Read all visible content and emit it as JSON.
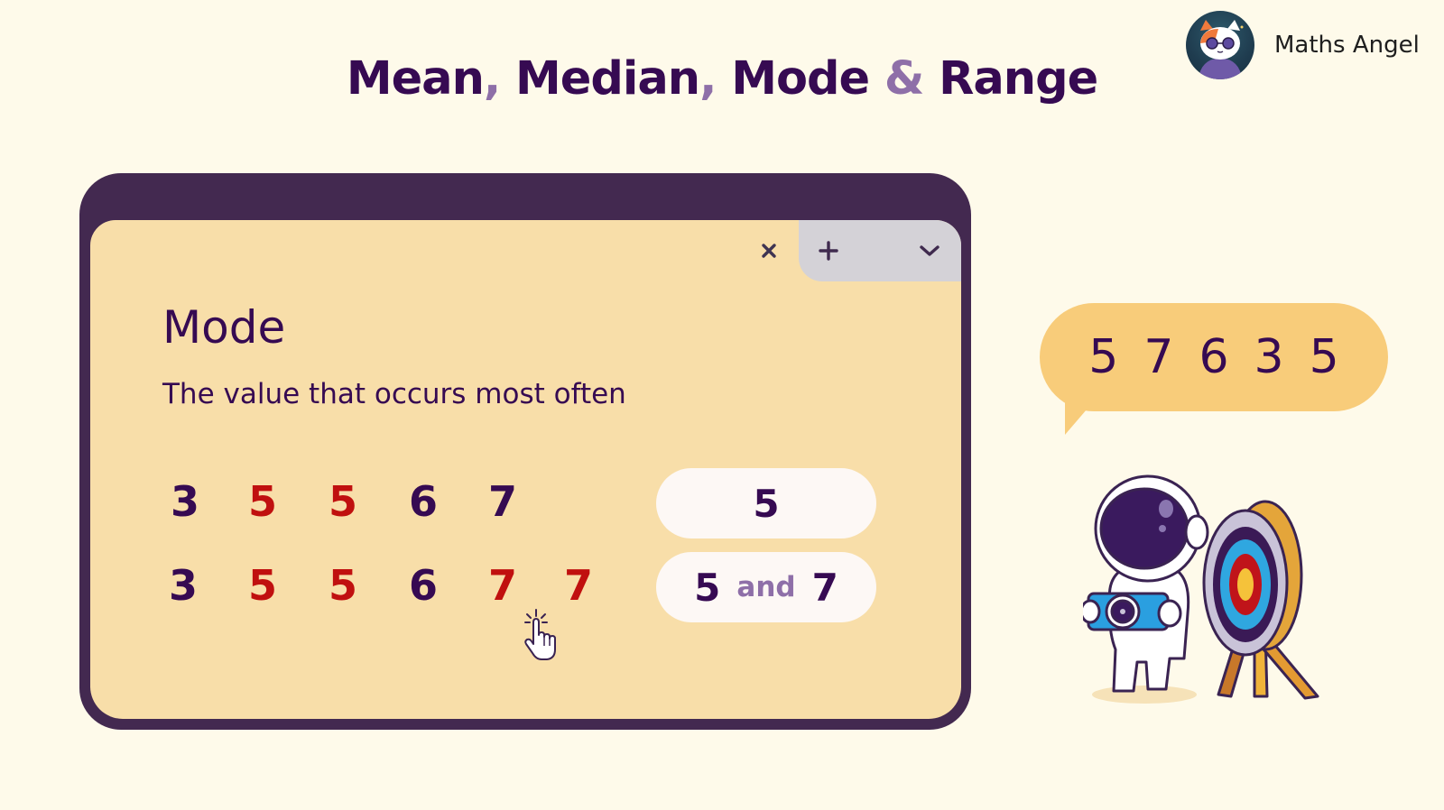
{
  "header": {
    "title_parts": [
      "Mean",
      ",",
      " Median",
      ",",
      " Mode",
      " & ",
      "Range"
    ]
  },
  "brand": {
    "name": "Maths Angel",
    "avatar_icon": "cat-with-sunglasses-avatar"
  },
  "browser": {
    "tab_close_icon": "close-icon",
    "tab_new_icon": "plus-icon",
    "tab_menu_icon": "chevron-down-icon",
    "card": {
      "title": "Mode",
      "description": "The value that occurs most often",
      "examples": [
        {
          "values": [
            {
              "v": "3",
              "is_mode": false
            },
            {
              "v": "5",
              "is_mode": true
            },
            {
              "v": "5",
              "is_mode": true
            },
            {
              "v": "6",
              "is_mode": false
            },
            {
              "v": "7",
              "is_mode": false
            }
          ],
          "answer": {
            "first": "5"
          }
        },
        {
          "values": [
            {
              "v": "3",
              "is_mode": false
            },
            {
              "v": "5",
              "is_mode": true
            },
            {
              "v": "5",
              "is_mode": true
            },
            {
              "v": "6",
              "is_mode": false
            },
            {
              "v": "7",
              "is_mode": true
            },
            {
              "v": "7",
              "is_mode": true
            }
          ],
          "answer": {
            "first": "5",
            "connector": "and",
            "second": "7"
          }
        }
      ]
    }
  },
  "speech_bubble": {
    "values": [
      "5",
      "7",
      "6",
      "3",
      "5"
    ]
  },
  "illustration": {
    "icon": "astronaut-with-camera-and-target"
  },
  "colors": {
    "background": "#fefaea",
    "primary_text": "#360a52",
    "accent_purple": "#8e6fa8",
    "mode_highlight": "#c0100f",
    "browser_frame": "#432950",
    "card_bg": "#f8dea9",
    "tab_strip": "#d4d2d7",
    "bubble": "#f8cc7a"
  }
}
